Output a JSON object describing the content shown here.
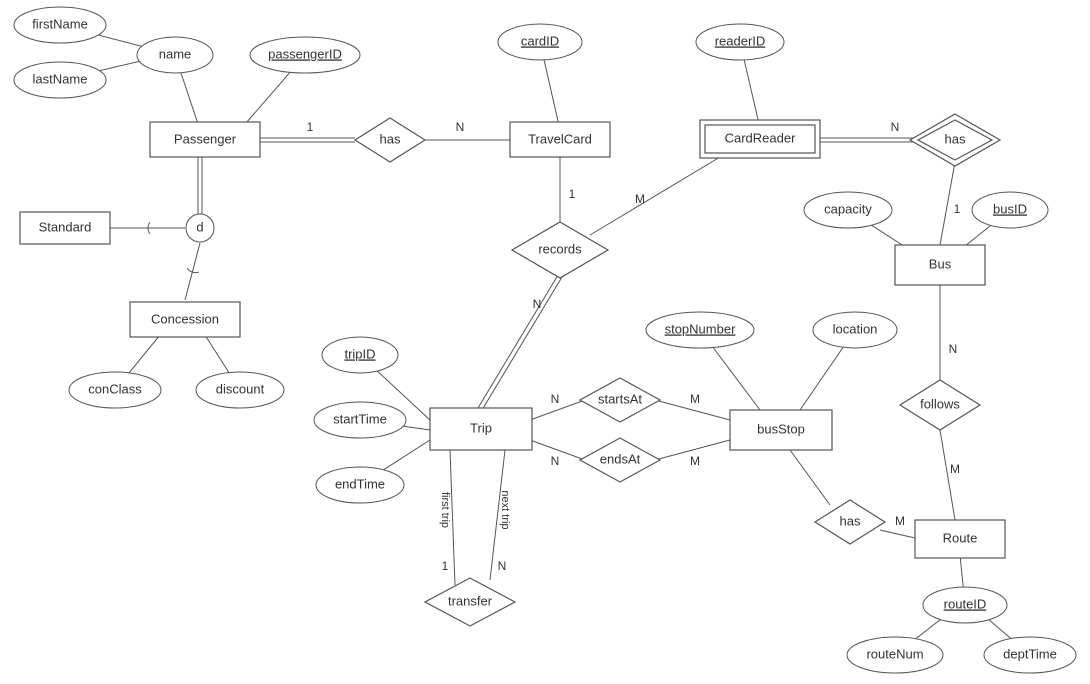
{
  "type": "ER-diagram",
  "entities": {
    "passenger": {
      "label": "Passenger",
      "kind": "entity"
    },
    "standard": {
      "label": "Standard",
      "kind": "entity"
    },
    "concession": {
      "label": "Concession",
      "kind": "entity"
    },
    "travelcard": {
      "label": "TravelCard",
      "kind": "entity"
    },
    "cardreader": {
      "label": "CardReader",
      "kind": "weak-entity"
    },
    "bus": {
      "label": "Bus",
      "kind": "entity"
    },
    "trip": {
      "label": "Trip",
      "kind": "entity"
    },
    "busstop": {
      "label": "busStop",
      "kind": "entity"
    },
    "route": {
      "label": "Route",
      "kind": "entity"
    }
  },
  "attributes": {
    "firstName": {
      "label": "firstName",
      "of": "name",
      "kind": "simple"
    },
    "lastName": {
      "label": "lastName",
      "of": "name",
      "kind": "simple"
    },
    "name": {
      "label": "name",
      "of": "passenger",
      "kind": "composite"
    },
    "passengerID": {
      "label": "passengerID",
      "of": "passenger",
      "kind": "key"
    },
    "cardID": {
      "label": "cardID",
      "of": "travelcard",
      "kind": "key"
    },
    "readerID": {
      "label": "readerID",
      "of": "cardreader",
      "kind": "key"
    },
    "capacity": {
      "label": "capacity",
      "of": "bus",
      "kind": "simple"
    },
    "busID": {
      "label": "busID",
      "of": "bus",
      "kind": "key"
    },
    "conClass": {
      "label": "conClass",
      "of": "concession",
      "kind": "simple"
    },
    "discount": {
      "label": "discount",
      "of": "concession",
      "kind": "simple"
    },
    "tripID": {
      "label": "tripID",
      "of": "trip",
      "kind": "key"
    },
    "startTime": {
      "label": "startTime",
      "of": "trip",
      "kind": "simple"
    },
    "endTime": {
      "label": "endTime",
      "of": "trip",
      "kind": "simple"
    },
    "stopNumber": {
      "label": "stopNumber",
      "of": "busstop",
      "kind": "key"
    },
    "location": {
      "label": "location",
      "of": "busstop",
      "kind": "simple"
    },
    "routeID": {
      "label": "routeID",
      "of": "route",
      "kind": "key"
    },
    "routeNum": {
      "label": "routeNum",
      "of": "route",
      "kind": "simple"
    },
    "deptTime": {
      "label": "deptTime",
      "of": "route",
      "kind": "simple"
    }
  },
  "relationships": {
    "has_pass_card": {
      "label": "has",
      "between": [
        "passenger",
        "travelcard"
      ],
      "card": [
        "1",
        "N"
      ],
      "participation": [
        "total",
        "partial"
      ]
    },
    "has_reader_bus": {
      "label": "has",
      "between": [
        "cardreader",
        "bus"
      ],
      "card": [
        "N",
        "1"
      ],
      "participation": [
        "total",
        "partial"
      ],
      "identifying": true
    },
    "records": {
      "label": "records",
      "between": [
        "travelcard",
        "cardreader",
        "trip"
      ],
      "card": [
        "1",
        "M",
        "N"
      ],
      "participation_trip": "total"
    },
    "startsAt": {
      "label": "startsAt",
      "between": [
        "trip",
        "busstop"
      ],
      "card": [
        "N",
        "M"
      ]
    },
    "endsAt": {
      "label": "endsAt",
      "between": [
        "trip",
        "busstop"
      ],
      "card": [
        "N",
        "M"
      ]
    },
    "follows": {
      "label": "follows",
      "between": [
        "bus",
        "route"
      ],
      "card": [
        "N",
        "M"
      ]
    },
    "has_stop_route": {
      "label": "has",
      "between": [
        "busstop",
        "route"
      ],
      "card": [
        "",
        "M"
      ]
    },
    "transfer": {
      "label": "transfer",
      "between": [
        "trip",
        "trip"
      ],
      "roles": [
        "first trip",
        "next trip"
      ],
      "card": [
        "1",
        "N"
      ]
    }
  },
  "specialization": {
    "d_passenger": {
      "label": "d",
      "parent": "passenger",
      "children": [
        "standard",
        "concession"
      ],
      "disjoint": true,
      "total": true
    }
  },
  "cardinality_labels": {
    "c1": "1",
    "cN": "N",
    "cM": "M"
  },
  "role_labels": {
    "first_trip": "first trip",
    "next_trip": "next trip"
  }
}
